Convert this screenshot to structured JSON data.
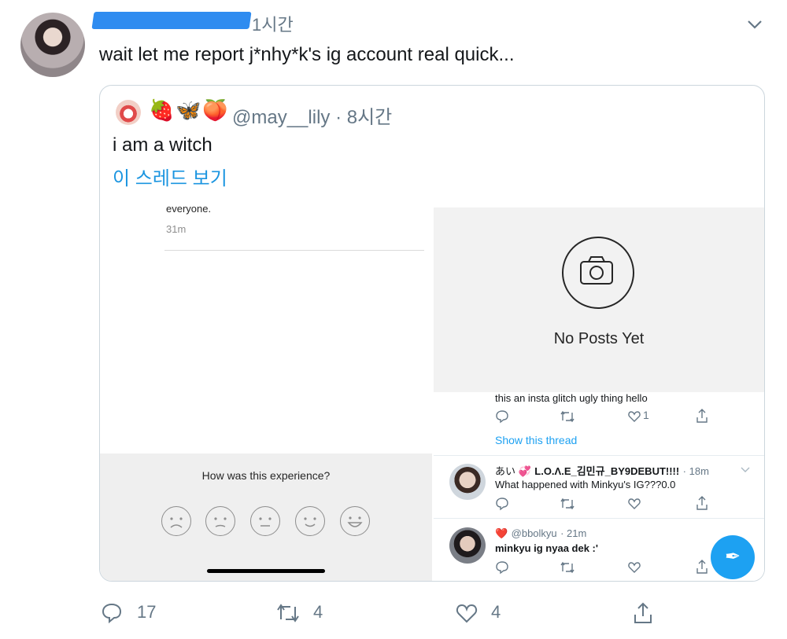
{
  "tweet": {
    "header_time": "1시간",
    "text": "wait let me report j*nhy*k's ig account real quick...",
    "actions": {
      "replies": "17",
      "retweets": "4",
      "likes": "4"
    }
  },
  "quoted": {
    "emojis": [
      "🍓",
      "🦋",
      "🍑"
    ],
    "handle_time": "@may__lily · 8시간",
    "text": "i am a witch",
    "thread_link": "이 스레드 보기"
  },
  "screenshot": {
    "snippet_text": "everyone.",
    "snippet_time": "31m",
    "no_posts": "No Posts Yet",
    "rating_question": "How was this experience?",
    "glitch_text": "this an insta glitch ugly thing hello",
    "like_count": "1",
    "show_thread": "Show this thread",
    "replies": [
      {
        "name_prefix": "あい 💞",
        "name": "L.O.Λ.E_김민규_BY9DEBUT!!!!",
        "time": "· 18m",
        "text": "What happened with Minkyu's IG???0.0"
      },
      {
        "name_prefix": "❤️",
        "name": "@bbolkyu",
        "time": "· 21m",
        "text": "minkyu ig nyaa dek :'"
      }
    ]
  }
}
